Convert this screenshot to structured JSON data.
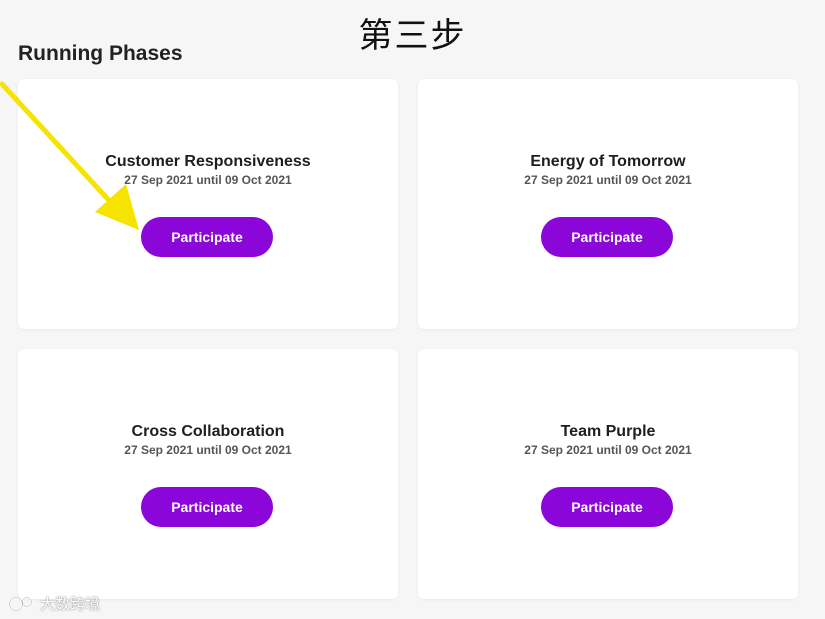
{
  "step_heading": "第三步",
  "section_title": "Running Phases",
  "phases": [
    {
      "title": "Customer Responsiveness",
      "dates": "27 Sep 2021 until 09 Oct 2021",
      "button_label": "Participate"
    },
    {
      "title": "Energy of Tomorrow",
      "dates": "27 Sep 2021 until 09 Oct 2021",
      "button_label": "Participate"
    },
    {
      "title": "Cross Collaboration",
      "dates": "27 Sep 2021 until 09 Oct 2021",
      "button_label": "Participate"
    },
    {
      "title": "Team Purple",
      "dates": "27 Sep 2021 until 09 Oct 2021",
      "button_label": "Participate"
    }
  ],
  "annotation": {
    "icon": "arrow-icon",
    "color": "#f5e400"
  },
  "watermark": {
    "text": "大数跨境",
    "icon": "logo-icon"
  },
  "colors": {
    "accent": "#8b07d9",
    "background": "#f6f6f6",
    "card": "#ffffff"
  }
}
